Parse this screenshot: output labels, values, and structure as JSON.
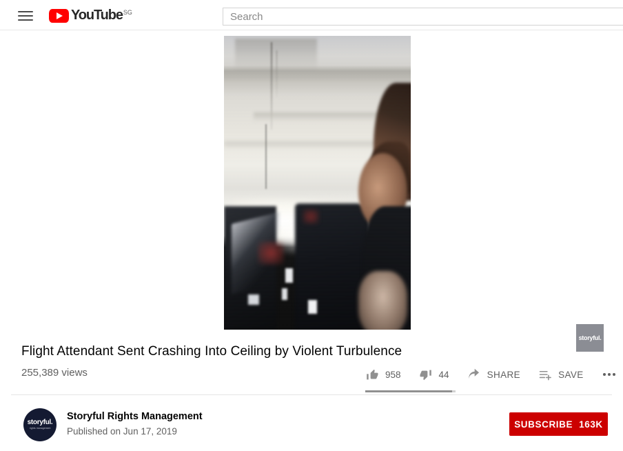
{
  "header": {
    "menu_icon": "hamburger-menu-icon",
    "logo_word": "YouTube",
    "logo_country": "SG",
    "search_placeholder": "Search",
    "search_value": ""
  },
  "player": {
    "watermark_label": "storyful.",
    "description": "Blurry handheld airplane cabin interior footage during turbulence"
  },
  "video": {
    "title": "Flight Attendant Sent Crashing Into Ceiling by Violent Turbulence",
    "views": "255,389 views"
  },
  "actions": {
    "like": {
      "icon": "thumbs-up-icon",
      "count": "958"
    },
    "dislike": {
      "icon": "thumbs-down-icon",
      "count": "44"
    },
    "share": {
      "icon": "share-arrow-icon",
      "label": "SHARE"
    },
    "save": {
      "icon": "save-playlist-icon",
      "label": "SAVE"
    },
    "more": {
      "icon": "more-horizontal-icon"
    },
    "like_ratio_percent": 96
  },
  "channel": {
    "avatar_main": "storyful.",
    "avatar_sub": "rights management",
    "name": "Storyful Rights Management",
    "published": "Published on Jun 17, 2019",
    "subscribe_label": "SUBSCRIBE",
    "subscriber_count": "163K"
  },
  "colors": {
    "brand_red": "#ff0000",
    "subscribe_red": "#cc0000",
    "text_primary": "#030303",
    "text_secondary": "#606060",
    "avatar_navy": "#141a32",
    "watermark_gray": "#8b8d94"
  }
}
